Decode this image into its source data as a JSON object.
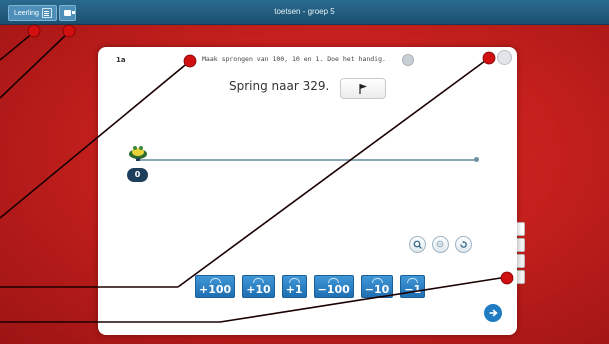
{
  "window": {
    "title": "toetsen - groep 5"
  },
  "toolbar": {
    "user_label": "Leerling"
  },
  "question": {
    "number": "1a",
    "instruction": "Maak sprongen van 100, 10 en 1. Doe het handig.",
    "task": "Spring naar 329."
  },
  "numberline": {
    "start_label": "0"
  },
  "jump_buttons": [
    "+100",
    "+10",
    "+1",
    "−100",
    "−10",
    "−1"
  ],
  "colors": {
    "background": "#c5201d",
    "topbar": "#1c4f6e",
    "jump_button": "#1f6fb2",
    "annotation": "#cc1010"
  }
}
